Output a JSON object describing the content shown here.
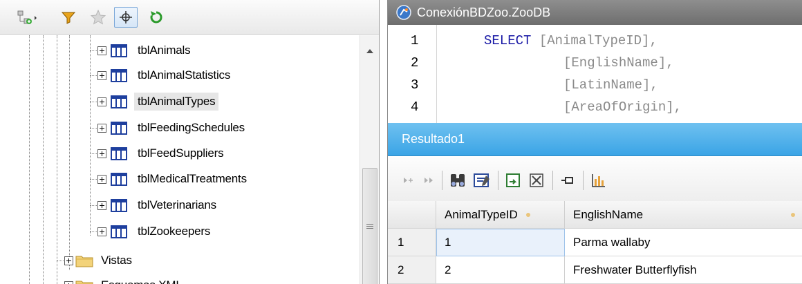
{
  "tree": {
    "tables": [
      {
        "label": "tblAnimals"
      },
      {
        "label": "tblAnimalStatistics"
      },
      {
        "label": "tblAnimalTypes"
      },
      {
        "label": "tblFeedingSchedules"
      },
      {
        "label": "tblFeedSuppliers"
      },
      {
        "label": "tblMedicalTreatments"
      },
      {
        "label": "tblVeterinarians"
      },
      {
        "label": "tblZookeepers"
      }
    ],
    "selected_table": "tblAnimalTypes",
    "folders": [
      {
        "label": "Vistas"
      },
      {
        "label": "Esquemas XML"
      }
    ]
  },
  "sql_editor": {
    "title": "ConexiónBDZoo.ZooDB",
    "lines": [
      {
        "num": "1",
        "keyword": "SELECT",
        "text": " [AnimalTypeID],"
      },
      {
        "num": "2",
        "keyword": "",
        "text": "[EnglishName],"
      },
      {
        "num": "3",
        "keyword": "",
        "text": "[LatinName],"
      },
      {
        "num": "4",
        "keyword": "",
        "text": "[AreaOfOrigin],"
      }
    ]
  },
  "result": {
    "tab_label": "Resultado1",
    "columns": [
      "AnimalTypeID",
      "EnglishName"
    ],
    "rows": [
      {
        "num": "1",
        "cells": [
          "1",
          "Parma wallaby"
        ]
      },
      {
        "num": "2",
        "cells": [
          "2",
          "Freshwater Butterflyfish"
        ]
      }
    ]
  },
  "colors": {
    "result_tab": "#3aa4e6",
    "sql_keyword": "#1a1aa6",
    "selection": "#e6e6e6"
  }
}
